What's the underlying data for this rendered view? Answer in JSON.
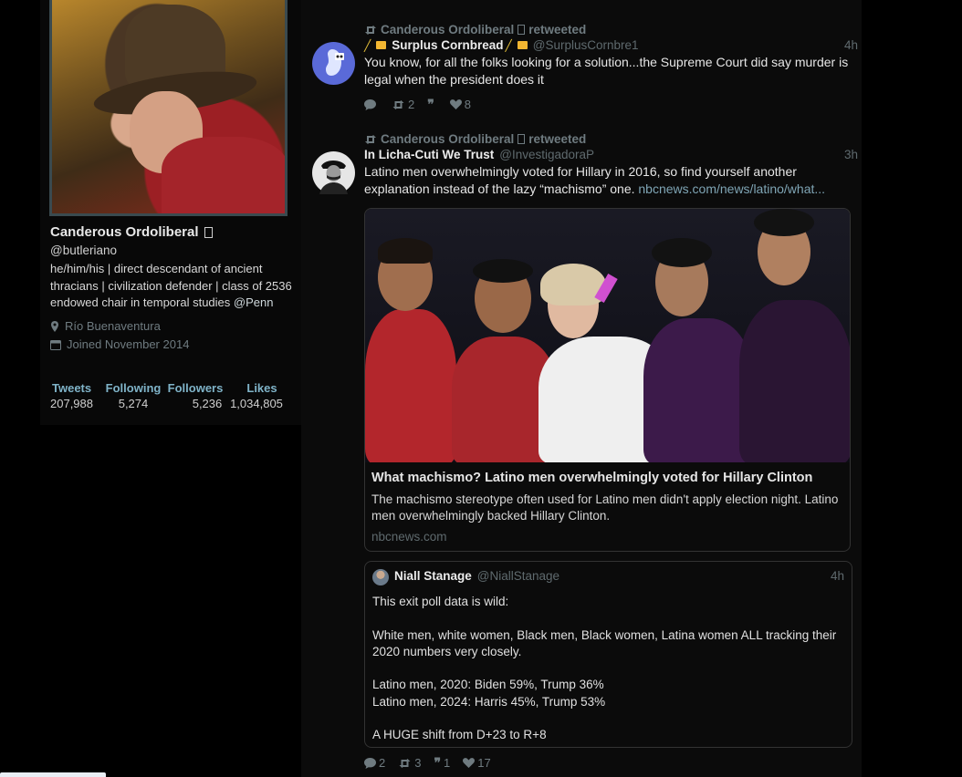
{
  "profile": {
    "name": "Canderous Ordoliberal",
    "handle": "@butleriano",
    "bio": "he/him/his | direct descendant of ancient thracians | civilization defender | class of 2536 endowed chair in temporal studies",
    "bio_mention": "@Penn",
    "location": "Río Buenaventura",
    "joined": "Joined November 2014",
    "stats": [
      {
        "label": "Tweets",
        "value": "207,988"
      },
      {
        "label": "Following",
        "value": "5,274"
      },
      {
        "label": "Followers",
        "value": "5,236"
      },
      {
        "label": "Likes",
        "value": "1,034,805"
      }
    ]
  },
  "tweets": [
    {
      "retweet_text": "Canderous Ordoliberal",
      "retweet_suffix": "retweeted",
      "name": "Surplus Cornbread",
      "handle": "@SurplusCornbre1",
      "time": "4h",
      "text": "You know, for all the folks looking for a solution...the Supreme Court did say murder is legal when the president does it",
      "actions": {
        "reply": "",
        "retweet": "2",
        "quote": "",
        "like": "8"
      }
    },
    {
      "retweet_text": "Canderous Ordoliberal",
      "retweet_suffix": "retweeted",
      "name": "In Licha-Cuti We Trust",
      "handle": "@InvestigadoraP",
      "time": "3h",
      "text": "Latino men overwhelmingly voted for Hillary in 2016, so find yourself another explanation instead of the lazy “machismo” one.",
      "link": "nbcnews.com/news/latino/what...",
      "card": {
        "title": "What machismo? Latino men overwhelmingly voted for Hillary Clinton",
        "description": "The machismo stereotype often used for Latino men didn't apply election night. Latino men overwhelmingly backed Hillary Clinton.",
        "domain": "nbcnews.com"
      },
      "quote": {
        "name": "Niall Stanage",
        "handle": "@NiallStanage",
        "time": "4h",
        "text": "This exit poll data is wild:\n\nWhite men, white women, Black men, Black women, Latina women ALL  tracking their 2020 numbers very closely.\n\nLatino men, 2020: Biden 59%, Trump 36%\nLatino men, 2024: Harris 45%, Trump 53%\n\nA HUGE shift from D+23 to R+8"
      },
      "actions": {
        "reply": "2",
        "retweet": "3",
        "quote": "1",
        "like": "17"
      }
    }
  ],
  "colors": {
    "background": "#000000",
    "link": "#7fa5b5",
    "stat_label": "#7fb3c8",
    "muted": "#6f7b80"
  }
}
